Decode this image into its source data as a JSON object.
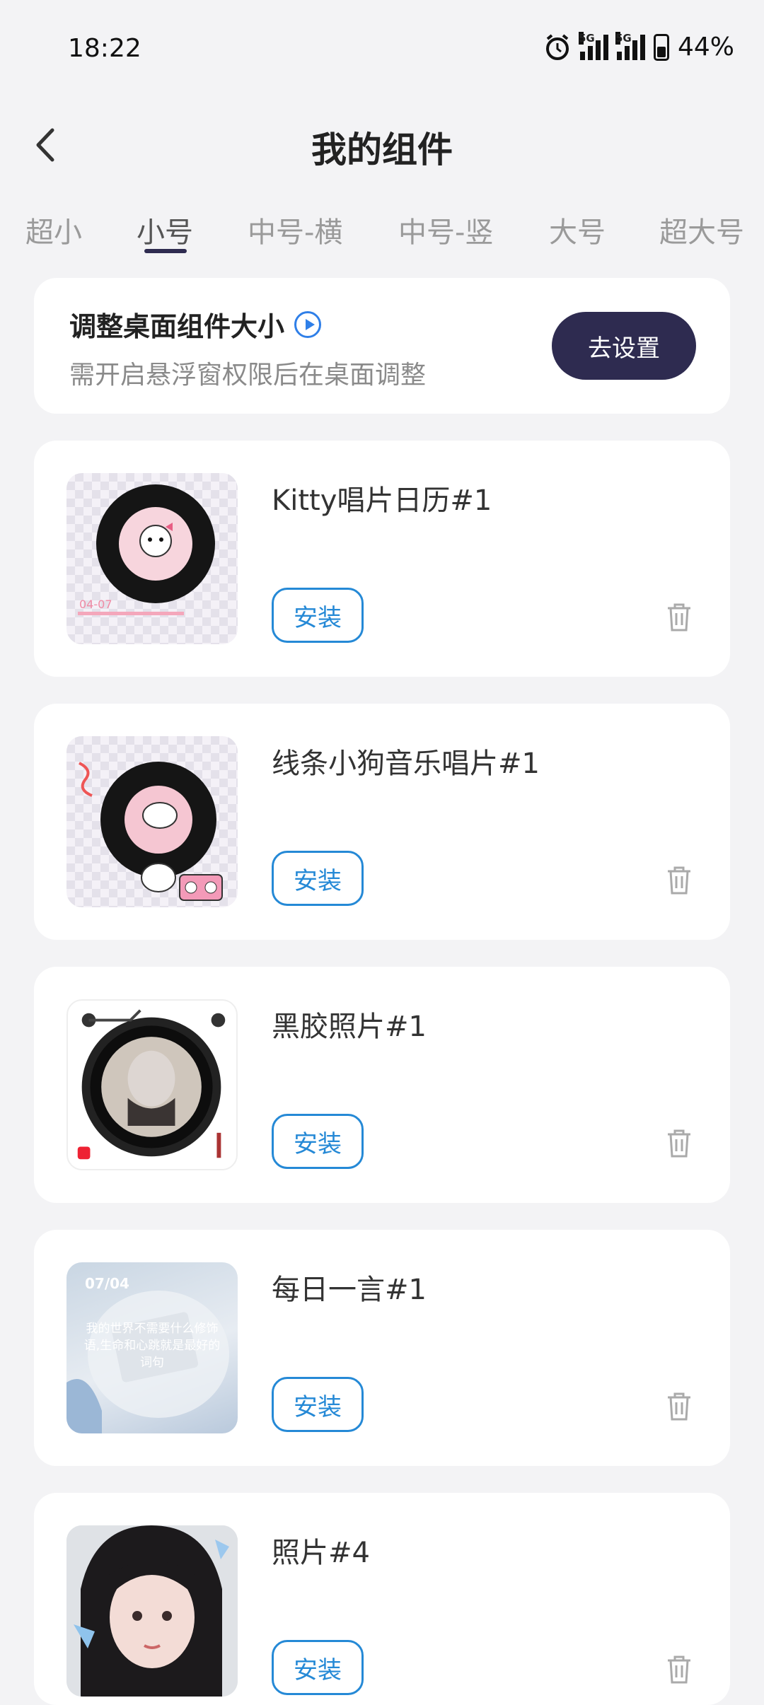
{
  "status_bar": {
    "time": "18:22",
    "signal1_label": "5G",
    "signal2_label": "5G",
    "battery": "44%"
  },
  "header": {
    "title": "我的组件"
  },
  "tabs": [
    {
      "label": "超小"
    },
    {
      "label": "小号"
    },
    {
      "label": "中号-横"
    },
    {
      "label": "中号-竖"
    },
    {
      "label": "大号"
    },
    {
      "label": "超大号"
    }
  ],
  "active_tab": "小号",
  "banner": {
    "title": "调整桌面组件大小",
    "subtitle": "需开启悬浮窗权限后在桌面调整",
    "button": "去设置"
  },
  "widgets": [
    {
      "name": "Kitty唱片日历#1",
      "install": "安装",
      "thumb_icon": "hello-kitty-record-thumbnail",
      "thumb_text": "04-07"
    },
    {
      "name": "线条小狗音乐唱片#1",
      "install": "安装",
      "thumb_icon": "line-puppy-record-thumbnail"
    },
    {
      "name": "黑胶照片#1",
      "install": "安装",
      "thumb_icon": "vinyl-photo-thumbnail"
    },
    {
      "name": "每日一言#1",
      "install": "安装",
      "thumb_icon": "daily-quote-thumbnail",
      "thumb_date": "07/04",
      "thumb_quote": "我的世界不需要什么修饰语,生命和心跳就是最好的词句"
    },
    {
      "name": "照片#4",
      "install": "安装",
      "thumb_icon": "photo-portrait-thumbnail"
    }
  ],
  "colors": {
    "accent_dark": "#2e2b50",
    "install_blue": "#2589d6",
    "background": "#f3f3f5"
  }
}
